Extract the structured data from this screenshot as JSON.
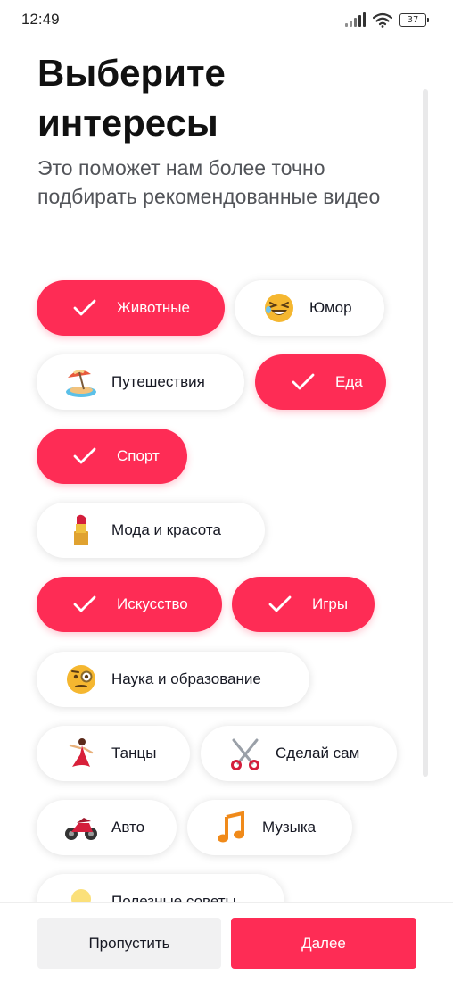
{
  "status_bar": {
    "time": "12:49",
    "battery": "37"
  },
  "header": {
    "title": "Выберите интересы",
    "subtitle": "Это поможет нам более точно подбирать рекомендованные видео"
  },
  "colors": {
    "accent": "#fe2c55",
    "chip_unselected": "#ffffff",
    "skip_bg": "#f1f1f2"
  },
  "interests": [
    {
      "label": "Животные",
      "selected": true,
      "icon": "check-icon"
    },
    {
      "label": "Юмор",
      "selected": false,
      "icon": "laughing-face-icon"
    },
    {
      "label": "Путешествия",
      "selected": false,
      "icon": "beach-umbrella-icon"
    },
    {
      "label": "Еда",
      "selected": true,
      "icon": "check-icon"
    },
    {
      "label": "Спорт",
      "selected": true,
      "icon": "check-icon"
    },
    {
      "label": "Мода и красота",
      "selected": false,
      "icon": "lipstick-icon"
    },
    {
      "label": "Искусство",
      "selected": true,
      "icon": "check-icon"
    },
    {
      "label": "Игры",
      "selected": true,
      "icon": "check-icon"
    },
    {
      "label": "Наука и образование",
      "selected": false,
      "icon": "monocle-face-icon"
    },
    {
      "label": "Танцы",
      "selected": false,
      "icon": "dancer-icon"
    },
    {
      "label": "Сделай сам",
      "selected": false,
      "icon": "scissors-icon"
    },
    {
      "label": "Авто",
      "selected": false,
      "icon": "motorcycle-icon"
    },
    {
      "label": "Музыка",
      "selected": false,
      "icon": "music-note-icon"
    },
    {
      "label": "Полезные советы",
      "selected": false,
      "icon": "lightbulb-icon"
    }
  ],
  "footer": {
    "skip_label": "Пропустить",
    "next_label": "Далее"
  }
}
